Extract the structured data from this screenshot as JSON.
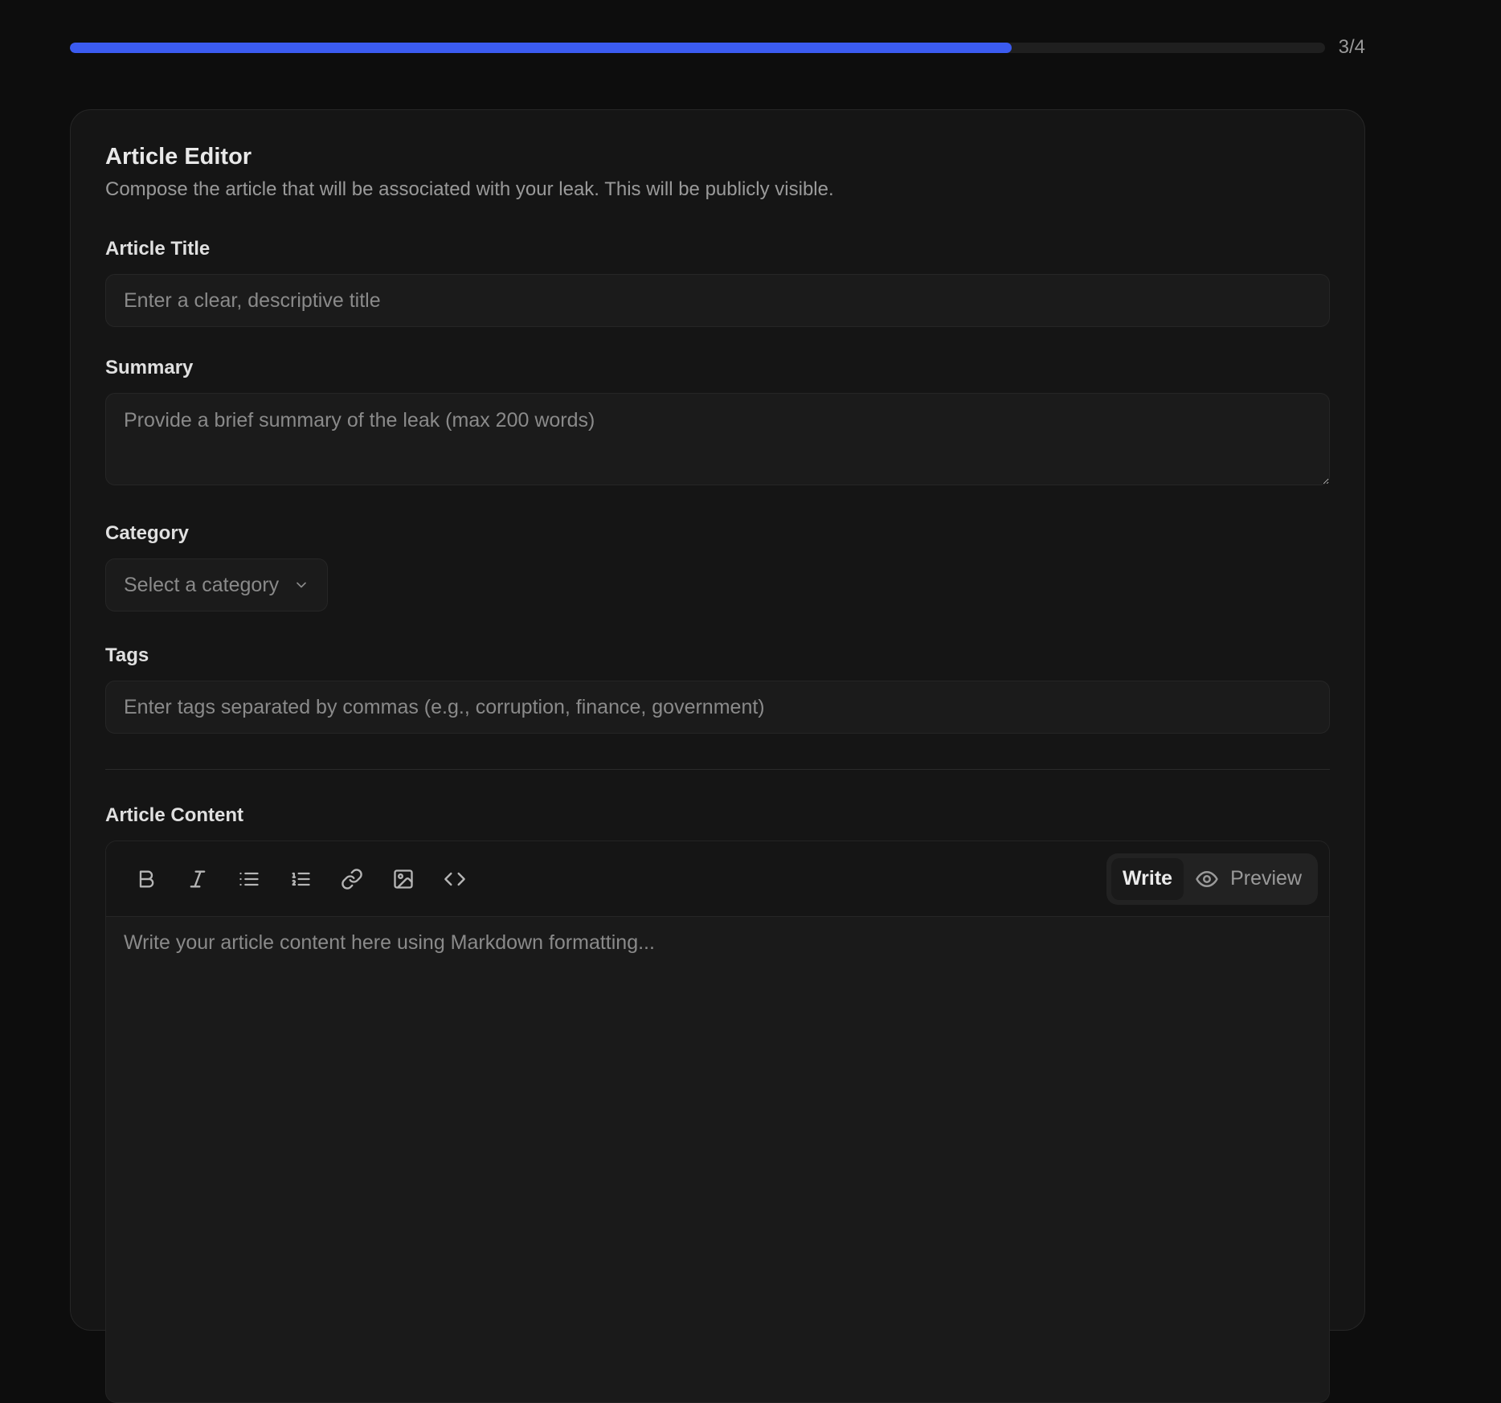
{
  "progress": {
    "label": "3/4",
    "value": 0.75,
    "fill_color": "#3b5bf0"
  },
  "card": {
    "title": "Article Editor",
    "subtitle": "Compose the article that will be associated with your leak. This will be publicly visible."
  },
  "fields": {
    "title": {
      "label": "Article Title",
      "placeholder": "Enter a clear, descriptive title",
      "value": ""
    },
    "summary": {
      "label": "Summary",
      "placeholder": "Provide a brief summary of the leak (max 200 words)",
      "value": ""
    },
    "category": {
      "label": "Category",
      "selected": "Select a category"
    },
    "tags": {
      "label": "Tags",
      "placeholder": "Enter tags separated by commas (e.g., corruption, finance, government)",
      "value": ""
    }
  },
  "content": {
    "label": "Article Content",
    "placeholder": "Write your article content here using Markdown formatting...",
    "toolbar_icons": [
      "bold-icon",
      "italic-icon",
      "bullet-list-icon",
      "numbered-list-icon",
      "link-icon",
      "image-icon",
      "code-icon"
    ],
    "modes": {
      "write": "Write",
      "preview": "Preview",
      "active": "write"
    }
  }
}
